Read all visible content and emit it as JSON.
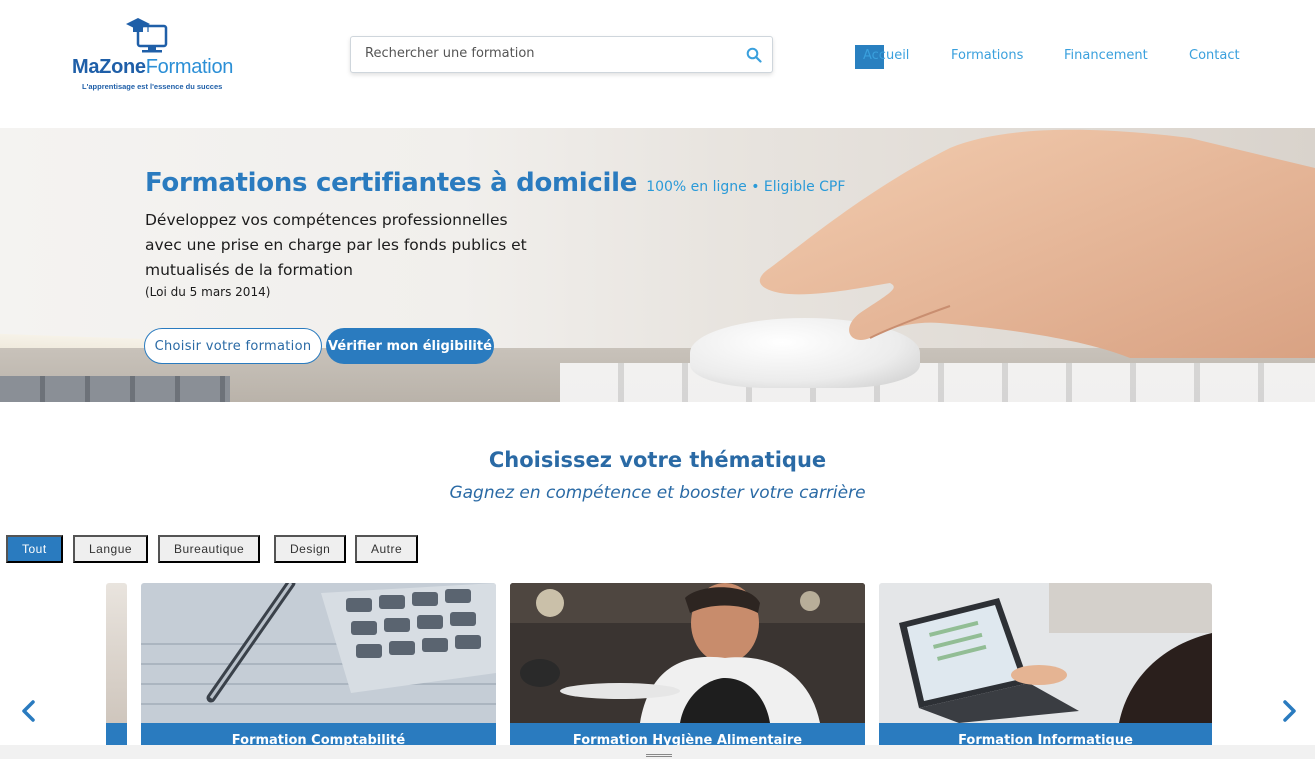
{
  "header": {
    "logo": {
      "name_part1": "MaZone",
      "name_part2": "Formation",
      "tagline": "L'apprentisage est l'essence du succes"
    },
    "search": {
      "placeholder": "Rechercher une formation"
    },
    "nav": [
      {
        "label": "Accueil",
        "active": true
      },
      {
        "label": "Formations",
        "active": false
      },
      {
        "label": "Financement",
        "active": false
      },
      {
        "label": "Contact",
        "active": false
      }
    ]
  },
  "hero": {
    "title": "Formations certifiantes à domicile",
    "title_suffix": "100% en ligne • Eligible CPF",
    "description": "Développez vos compétences professionnelles avec une prise en charge par les fonds publics et mutualisés de la formation",
    "law": "(Loi du 5 mars 2014)",
    "cta_primary": "Choisir votre formation",
    "cta_secondary": "Vérifier mon éligibilité"
  },
  "section": {
    "title": "Choisissez votre thématique",
    "subtitle": "Gagnez en compétence et booster votre carrière"
  },
  "filters": [
    {
      "label": "Tout",
      "active": true
    },
    {
      "label": "Langue",
      "active": false
    },
    {
      "label": "Bureautique",
      "active": false
    },
    {
      "label": "Design",
      "active": false
    },
    {
      "label": "Autre",
      "active": false
    }
  ],
  "cards": [
    {
      "label": "Formation Comptabilité"
    },
    {
      "label": "Formation Hygiène Alimentaire"
    },
    {
      "label": "Formation Informatique"
    }
  ],
  "colors": {
    "primary": "#2a7bbf",
    "nav_link": "#3aa0dd",
    "logo_blue": "#1f5fa8"
  },
  "icons": {
    "search": "search-icon",
    "prev": "chevron-left-icon",
    "next": "chevron-right-icon",
    "logo": "graduation-cap-monitor-icon"
  }
}
